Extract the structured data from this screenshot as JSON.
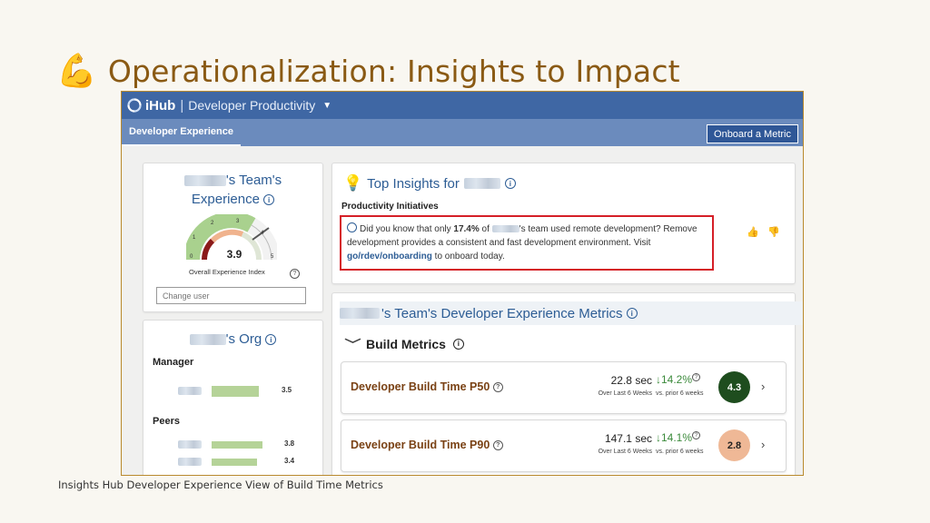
{
  "slide": {
    "title": "Operationalization: Insights to Impact",
    "caption": "Insights Hub Developer Experience View of Build Time Metrics"
  },
  "app": {
    "brand": "iHub",
    "separator": "|",
    "product": "Developer Productivity",
    "dropdown_icon": "caret-down-icon"
  },
  "nav": {
    "active_tab": "Developer Experience",
    "onboard_button": "Onboard a Metric"
  },
  "experience_card": {
    "title_suffix": "'s Team's",
    "title_line2": "Experience",
    "gauge": {
      "value": "3.9",
      "ticks": [
        "0",
        "1",
        "2",
        "3",
        "4",
        "5"
      ]
    },
    "index_label": "Overall Experience Index",
    "change_user_placeholder": "Change user"
  },
  "org_card": {
    "title_suffix": "'s Org",
    "manager_label": "Manager",
    "peers_label": "Peers",
    "manager": [
      {
        "value": 3.5,
        "label": "3.5"
      }
    ],
    "peers": [
      {
        "value": 3.8,
        "label": "3.8"
      },
      {
        "value": 3.4,
        "label": "3.4"
      }
    ]
  },
  "insights": {
    "title": "Top Insights for",
    "subtitle": "Productivity Initiatives",
    "text_a": "Did you know that only ",
    "highlight": "17.4%",
    "text_b": " of ",
    "text_c": "'s team used remote development? Remove development provides a consistent and fast development environment. Visit ",
    "link": "go/rdev/onboarding",
    "text_d": " to onboard today."
  },
  "metrics": {
    "header_suffix": "'s Team's Developer Experience Metrics",
    "section": "Build Metrics",
    "items": [
      {
        "name": "Developer Build Time P50",
        "value": "22.8 sec",
        "period": "Over Last 6 Weeks",
        "change": "14.2%",
        "prior": "vs. prior 6 weeks",
        "score": "4.3"
      },
      {
        "name": "Developer Build Time P90",
        "value": "147.1 sec",
        "period": "Over Last 6 Weeks",
        "change": "14.1%",
        "prior": "vs. prior 6 weeks",
        "score": "2.8"
      }
    ]
  },
  "colors": {
    "topbar": "#3f67a4",
    "navbar": "#6b8bbd",
    "title_text": "#8a5a14",
    "score_good": "#1e4d1e",
    "score_mid": "#efb896",
    "highlight_border": "#d51f27"
  }
}
